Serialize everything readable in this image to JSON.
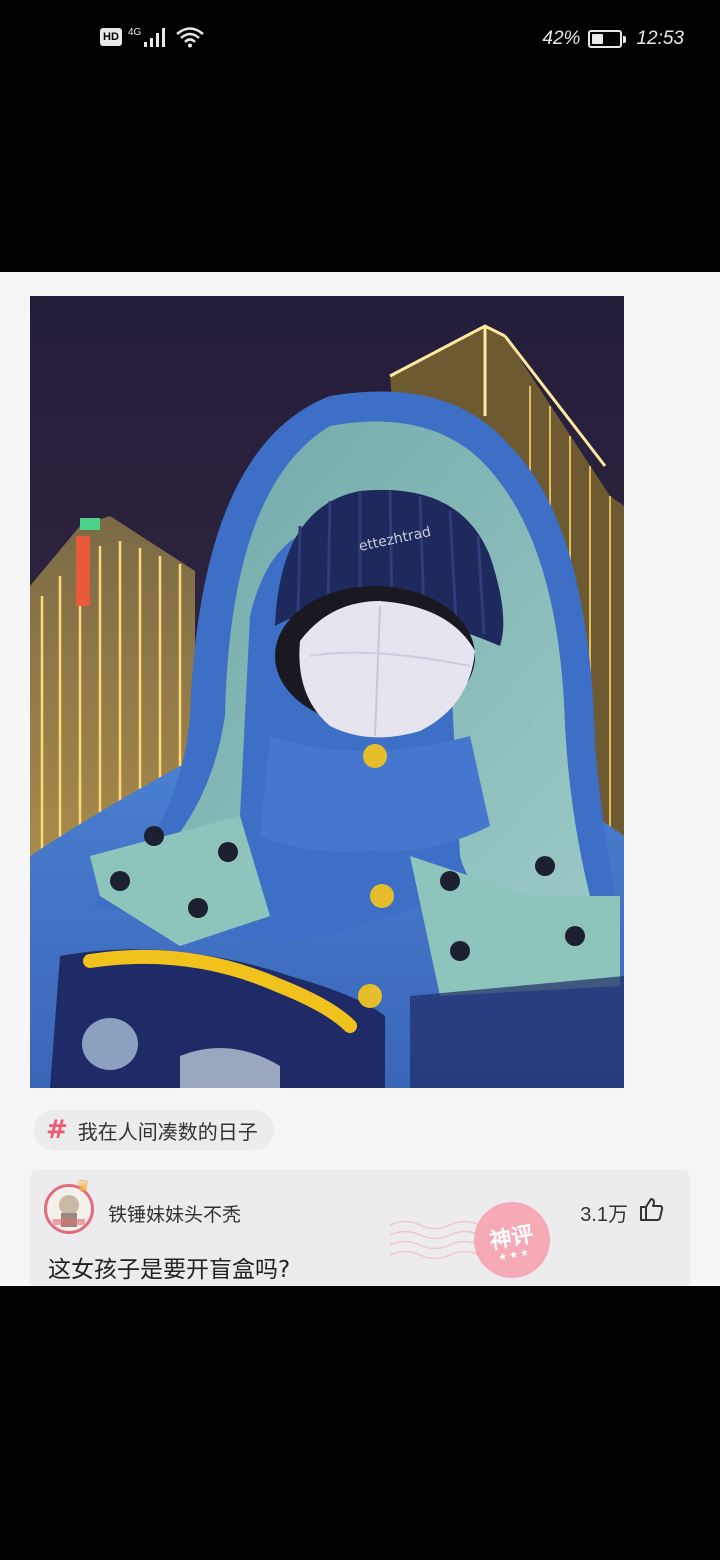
{
  "status_bar": {
    "hd_label": "HD",
    "network_label": "4G",
    "battery_text": "42%",
    "battery_level": 0.42,
    "time": "12:53"
  },
  "post": {
    "photo_icon": "selfie-photo",
    "topic_icon": "hash-icon",
    "topic": "我在人间凑数的日子",
    "hat_text": "ettezhtrad"
  },
  "comment": {
    "username": "铁锤妹妹头不秃",
    "text": "这女孩子是要开盲盒吗?",
    "like_count": "3.1万",
    "like_icon": "thumbs-up-icon",
    "badge": "神评",
    "badge_color": "#f6a3b1"
  }
}
